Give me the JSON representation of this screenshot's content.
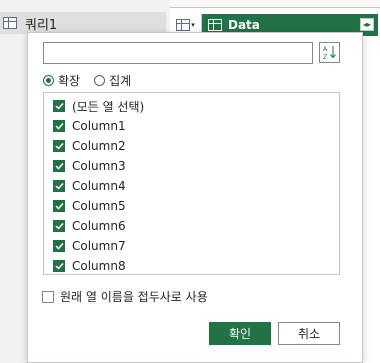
{
  "query_pane": {
    "query_name": "쿼리1",
    "query_icon": "table-icon"
  },
  "grid": {
    "column_header": "Data",
    "column_icon": "table-icon",
    "expand_icon": "expand-column-icon",
    "accent_color": "#217346"
  },
  "popup": {
    "search": {
      "value": "",
      "placeholder": ""
    },
    "sort_icon": "sort-az-icon",
    "radios": [
      {
        "label": "확장",
        "selected": true
      },
      {
        "label": "집계",
        "selected": false
      }
    ],
    "columns": [
      {
        "label": "(모든 열 선택)",
        "checked": true
      },
      {
        "label": "Column1",
        "checked": true
      },
      {
        "label": "Column2",
        "checked": true
      },
      {
        "label": "Column3",
        "checked": true
      },
      {
        "label": "Column4",
        "checked": true
      },
      {
        "label": "Column5",
        "checked": true
      },
      {
        "label": "Column6",
        "checked": true
      },
      {
        "label": "Column7",
        "checked": true
      },
      {
        "label": "Column8",
        "checked": true
      }
    ],
    "prefix_option": {
      "label": "원래 열 이름을 접두사로 사용",
      "checked": false
    },
    "ok_label": "확인",
    "cancel_label": "취소"
  }
}
